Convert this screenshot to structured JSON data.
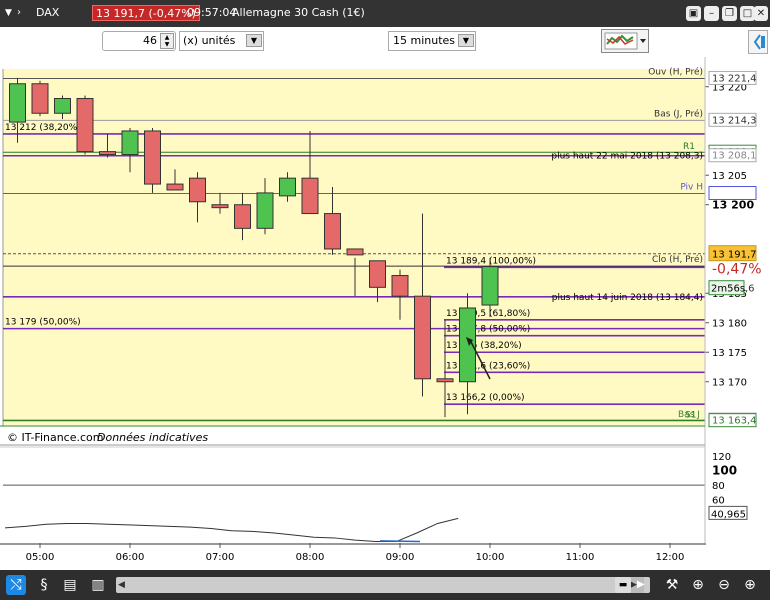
{
  "titlebar": {
    "symbol": "DAX",
    "price_badge": "13 191,7 (-0,47%)",
    "time": "09:57:04",
    "instrument": "Allemagne 30 Cash (1€)"
  },
  "toolbar": {
    "quantity": "46",
    "unit": "(x) unités",
    "timeframe": "15 minutes"
  },
  "chart_data": {
    "type": "candlestick",
    "instrument": "Allemagne 30 Cash (1€)",
    "timeframe": "15 minutes",
    "x_ticks": [
      "05:00",
      "06:00",
      "07:00",
      "08:00",
      "09:00",
      "10:00",
      "11:00",
      "12:00"
    ],
    "y_ticks": [
      "13 220",
      "13 205",
      "13 200",
      "13 185",
      "13 180",
      "13 175",
      "13 170"
    ],
    "ylim": [
      13162.5,
      13223
    ],
    "candles": [
      {
        "t": "04:45",
        "o": 13214.0,
        "h": 13221.5,
        "l": 13210.5,
        "c": 13220.5
      },
      {
        "t": "05:00",
        "o": 13220.5,
        "h": 13221.0,
        "l": 13215.0,
        "c": 13215.5
      },
      {
        "t": "05:15",
        "o": 13215.5,
        "h": 13218.5,
        "l": 13214.5,
        "c": 13218.0
      },
      {
        "t": "05:30",
        "o": 13218.0,
        "h": 13218.5,
        "l": 13208.5,
        "c": 13209.0
      },
      {
        "t": "05:45",
        "o": 13209.0,
        "h": 13212.0,
        "l": 13208.0,
        "c": 13208.5
      },
      {
        "t": "06:00",
        "o": 13208.5,
        "h": 13213.0,
        "l": 13205.5,
        "c": 13212.5
      },
      {
        "t": "06:15",
        "o": 13212.5,
        "h": 13213.0,
        "l": 13202.0,
        "c": 13203.5
      },
      {
        "t": "06:30",
        "o": 13203.5,
        "h": 13206.0,
        "l": 13203.0,
        "c": 13202.5
      },
      {
        "t": "06:45",
        "o": 13204.5,
        "h": 13205.5,
        "l": 13197.0,
        "c": 13200.5
      },
      {
        "t": "07:00",
        "o": 13200.0,
        "h": 13202.0,
        "l": 13198.5,
        "c": 13199.5
      },
      {
        "t": "07:15",
        "o": 13200.0,
        "h": 13202.0,
        "l": 13194.0,
        "c": 13196.0
      },
      {
        "t": "07:30",
        "o": 13196.0,
        "h": 13204.5,
        "l": 13195.0,
        "c": 13202.0
      },
      {
        "t": "07:45",
        "o": 13201.5,
        "h": 13205.5,
        "l": 13200.5,
        "c": 13204.5
      },
      {
        "t": "08:00",
        "o": 13204.5,
        "h": 13212.5,
        "l": 13198.5,
        "c": 13198.5
      },
      {
        "t": "08:15",
        "o": 13198.5,
        "h": 13203.0,
        "l": 13191.5,
        "c": 13192.5
      },
      {
        "t": "08:30",
        "o": 13192.5,
        "h": 13191.0,
        "l": 13184.5,
        "c": 13191.5
      },
      {
        "t": "08:45",
        "o": 13190.5,
        "h": 13190.0,
        "l": 13183.5,
        "c": 13186.0
      },
      {
        "t": "09:00",
        "o": 13188.0,
        "h": 13189.0,
        "l": 13180.5,
        "c": 13184.5
      },
      {
        "t": "09:15",
        "o": 13184.5,
        "h": 13198.5,
        "l": 13167.5,
        "c": 13170.5
      },
      {
        "t": "09:30",
        "o": 13170.5,
        "h": 13180.5,
        "l": 13164.0,
        "c": 13170.0
      },
      {
        "t": "09:45",
        "o": 13170.0,
        "h": 13185.0,
        "l": 13164.5,
        "c": 13182.5
      },
      {
        "t": "10:00",
        "o": 13183.0,
        "h": 13191.0,
        "l": 13181.0,
        "c": 13189.5
      }
    ],
    "levels": [
      {
        "label": "Ouv (H, Pré)",
        "value": 13221.4,
        "color": "#555555",
        "style": "solid",
        "axis": "13 221,4"
      },
      {
        "label": "Bas (J, Pré)",
        "value": 13214.3,
        "color": "#999999",
        "style": "solid",
        "axis": "13 214,3"
      },
      {
        "label": "13 212 (38,20%)",
        "value": 13212.0,
        "color": "#7a2ab8",
        "style": "solid",
        "axis": ""
      },
      {
        "label": "R1",
        "value": 13208.9,
        "color": "#2a7a2a",
        "style": "solid",
        "axis": "13 208,9"
      },
      {
        "label": "plus haut 22 mai 2018 (13 208,3)",
        "value": 13208.3,
        "color": "#7a2ab8",
        "style": "solid",
        "axis": "13 208,1"
      },
      {
        "label": "Piv H",
        "value": 13201.9,
        "color": "#5555dd",
        "style": "solid",
        "axis": "13 201,9"
      },
      {
        "label": "",
        "value": 13191.7,
        "color": "#555555",
        "style": "dashed",
        "axis": ""
      },
      {
        "label": "Clo (H, Pré)",
        "value": 13189.6,
        "color": "#333333",
        "style": "solid",
        "axis": ""
      },
      {
        "label": "plus haut 14 juin 2018 (13 184,4)",
        "value": 13184.4,
        "color": "#7a2ab8",
        "style": "solid",
        "axis": ""
      },
      {
        "label": "13 179 (50,00%)",
        "value": 13179.0,
        "color": "#7a2ab8",
        "style": "solid",
        "axis": ""
      },
      {
        "label": "Bas J",
        "value": 13163.5,
        "color": "#3a8a3a",
        "style": "solid",
        "axis": "13 163,5"
      },
      {
        "label": "S1",
        "value": 13163.4,
        "color": "#2a7a2a",
        "style": "solid",
        "axis": "13 163,4"
      }
    ],
    "fib_levels": [
      {
        "label": "13 189,4 (100,00%)",
        "value": 13189.4
      },
      {
        "label": "13 180,5 (61,80%)",
        "value": 13180.5
      },
      {
        "label": "13 177,8 (50,00%)",
        "value": 13177.8
      },
      {
        "label": "13 175 (38,20%)",
        "value": 13175.0
      },
      {
        "label": "13 171,6 (23,60%)",
        "value": 13171.6
      },
      {
        "label": "13 166,2 (0,00%)",
        "value": 13166.2
      }
    ],
    "last_price": "13 191,7",
    "change": "-0,47%",
    "timer": "2m56s",
    "timer_suffix": ",6",
    "r1_label": "R1",
    "s1_label": "S1",
    "basj_label": "Bas J",
    "pivh_label": "Piv H",
    "copyright": "© IT-Finance.com",
    "disclaimer": "Données indicatives",
    "indicator": {
      "y_ticks": [
        "120",
        "100",
        "80",
        "60"
      ],
      "ylim": [
        0,
        130
      ],
      "value_label": "40,965",
      "values": [
        21,
        23,
        26,
        27,
        27,
        26,
        25,
        24,
        23,
        22,
        20,
        17,
        16,
        14,
        11,
        8,
        7,
        4,
        2,
        2,
        14,
        27,
        34
      ]
    }
  },
  "colors": {
    "up": "#4fc34f",
    "down": "#e46a6a",
    "plot_bg": "#fff9c4",
    "price_badge": "#f9c236"
  },
  "bottombar": {
    "icons": [
      "share-icon",
      "instrument-icon",
      "list-icon",
      "chart-list-icon",
      "scroll-left",
      "scroll-right",
      "tools-icon",
      "crosshair-icon",
      "zoom-out-icon",
      "zoom-in-icon"
    ]
  }
}
